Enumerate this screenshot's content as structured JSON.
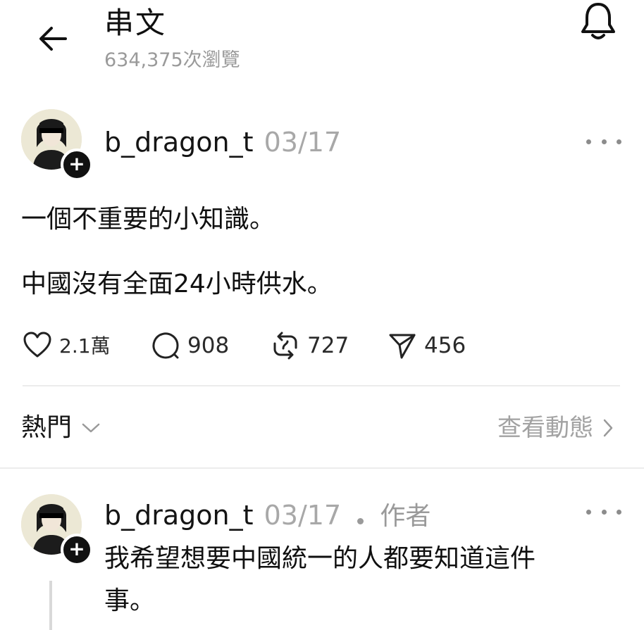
{
  "header": {
    "title": "串文",
    "views": "634,375次瀏覽"
  },
  "post": {
    "username": "b_dragon_t",
    "date": "03/17",
    "lines": [
      "一個不重要的小知識。",
      "中國沒有全面24小時供水。"
    ],
    "actions": {
      "likes": "2.1萬",
      "comments": "908",
      "reposts": "727",
      "shares": "456"
    }
  },
  "section": {
    "label": "熱門",
    "link": "查看動態"
  },
  "reply": {
    "username": "b_dragon_t",
    "date": "03/17",
    "author_tag": "作者",
    "lines": [
      "我希望想要中國統一的人都要知道這件",
      "事。"
    ]
  },
  "colors": {
    "text": "#101010",
    "muted": "#9a9a9a",
    "divider": "#ececec"
  },
  "icons": [
    "back-arrow-icon",
    "bell-icon",
    "more-icon",
    "heart-icon",
    "comment-icon",
    "repost-icon",
    "share-icon",
    "chevron-down-icon",
    "chevron-right-icon",
    "plus-icon"
  ]
}
